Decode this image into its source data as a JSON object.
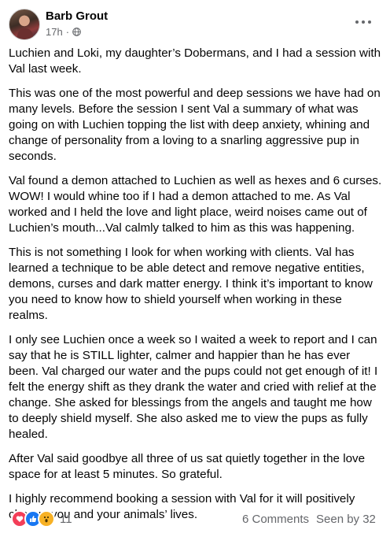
{
  "post": {
    "author": "Barb Grout",
    "time": "17h",
    "separator": "·",
    "privacy_icon": "globe-icon",
    "menu_icon": "more-horizontal-icon",
    "paragraphs": [
      "Luchien and  Loki, my daughter’s Dobermans, and I had a session with Val last week.",
      "This was one of the most powerful and deep sessions we have had on many levels. Before the session I sent Val a summary of what was going on with Luchien topping the list with deep anxiety, whining and change of personality from a loving to a snarling aggressive pup in seconds.",
      "Val found a demon attached to Luchien as well as hexes and 6 curses. WOW! I would whine too if I had a demon attached to me. As Val worked and I held the love and light place, weird noises came out of Luchien’s mouth...Val calmly talked to him as this was happening.",
      "This is not something I look for when working with clients. Val has learned a technique to be able detect and remove negative entities, demons, curses and dark matter energy. I think it’s important to know you need to know how to shield yourself when working in these realms.",
      "I only see Luchien once a week so I waited a week to report and I can say that he is STILL lighter, calmer and happier than he has ever been. Val charged our water and the pups could not get enough of it! I felt the energy shift as they drank the water and cried with relief at the change. She asked for blessings from the angels and taught me how to deeply shield myself. She also asked me to view the pups as fully healed.",
      "After Val said goodbye all three of us sat quietly together in the love space for at least 5 minutes. So grateful.",
      "I highly recommend booking a session with Val for it will positively change you and your animals’ lives."
    ]
  },
  "footer": {
    "reactions": [
      "love-reaction-icon",
      "like-reaction-icon",
      "wow-reaction-icon"
    ],
    "reaction_count": "11",
    "comments": "6 Comments",
    "seen_by": "Seen by 32"
  },
  "colors": {
    "text": "#050505",
    "secondary": "#65676b",
    "like": "#1877f2",
    "love": "#f33e58",
    "wow": "#f7b125"
  }
}
